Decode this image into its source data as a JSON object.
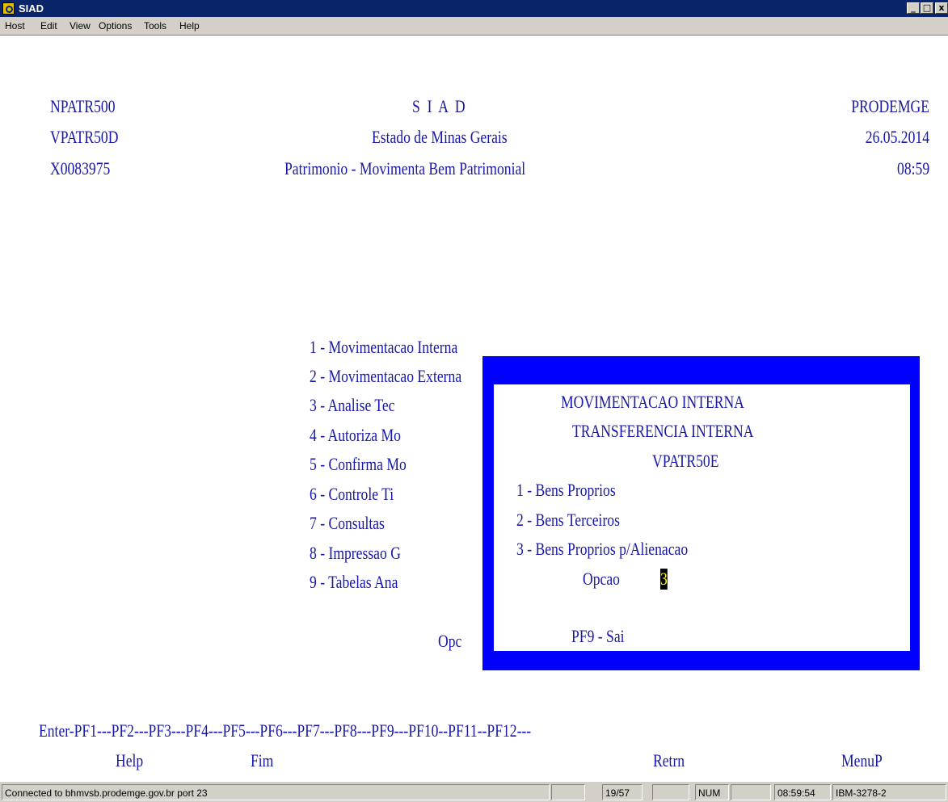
{
  "window": {
    "title": "SIAD",
    "min_glyph": "_",
    "max_glyph": "□",
    "close_glyph": "x"
  },
  "menu": [
    "Host",
    "Edit",
    "View",
    "Options",
    "Tools",
    "Help"
  ],
  "header": {
    "program": "NPATR500",
    "view": "VPATR50D",
    "user": "X0083975",
    "system": "S  I  A  D",
    "state": "Estado de Minas Gerais",
    "screen_title": "Patrimonio - Movimenta Bem Patrimonial",
    "company": "PRODEMGE",
    "date": "26.05.2014",
    "time": "08:59"
  },
  "main_menu": [
    "1 - Movimentacao Interna",
    "2 - Movimentacao Externa",
    "3 - Analise Tec",
    "4 - Autoriza Mo",
    "5 - Confirma Mo",
    "6 - Controle Ti",
    "7 - Consultas",
    "8 - Impressao G",
    "9 - Tabelas Ana"
  ],
  "main_option_label": "Opc",
  "popup": {
    "title": "MOVIMENTACAO INTERNA",
    "subtitle": "TRANSFERENCIA INTERNA",
    "view": "VPATR50E",
    "options": [
      "1 - Bens Proprios",
      "2 - Bens Terceiros",
      "3 - Bens Proprios p/Alienacao"
    ],
    "option_label": "Opcao",
    "option_value": "3",
    "exit": "PF9 - Sai"
  },
  "function_keys": {
    "line": "Enter-PF1---PF2---PF3---PF4---PF5---PF6---PF7---PF8---PF9---PF10--PF11--PF12---",
    "help": "Help",
    "fim": "Fim",
    "retrn": "Retrn",
    "menup": "MenuP"
  },
  "status": {
    "connection": "Connected to bhmvsb.prodemge.gov.br port 23",
    "cursor_pos": "19/57",
    "num": "NUM",
    "clock": "08:59:54",
    "terminal_type": "IBM-3278-2"
  }
}
